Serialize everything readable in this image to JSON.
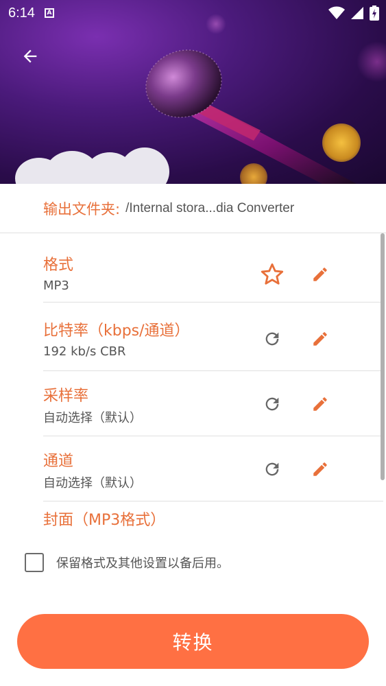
{
  "status_bar": {
    "time": "6:14",
    "notification_badge": "A"
  },
  "header": {
    "back_icon": "arrow-left-icon"
  },
  "output": {
    "label": "输出文件夹:",
    "path": "/Internal stora...dia Converter"
  },
  "settings": [
    {
      "title": "格式",
      "value": "MP3",
      "action1_icon": "star-outline-icon",
      "action2_icon": "pencil-icon"
    },
    {
      "title": "比特率（kbps/通道）",
      "value": "192 kb/s CBR",
      "action1_icon": "redo-icon",
      "action2_icon": "pencil-icon"
    },
    {
      "title": "采样率",
      "value": "自动选择（默认）",
      "action1_icon": "redo-icon",
      "action2_icon": "pencil-icon"
    },
    {
      "title": "通道",
      "value": "自动选择（默认）",
      "action1_icon": "redo-icon",
      "action2_icon": "pencil-icon"
    }
  ],
  "cover": {
    "title": "封面（MP3格式）"
  },
  "keep_settings": {
    "label": "保留格式及其他设置以备后用。",
    "checked": false
  },
  "convert_button": {
    "label": "转换"
  },
  "colors": {
    "accent": "#e8703a",
    "button": "#ff7043",
    "hero_purple": "#4a1a7a"
  }
}
